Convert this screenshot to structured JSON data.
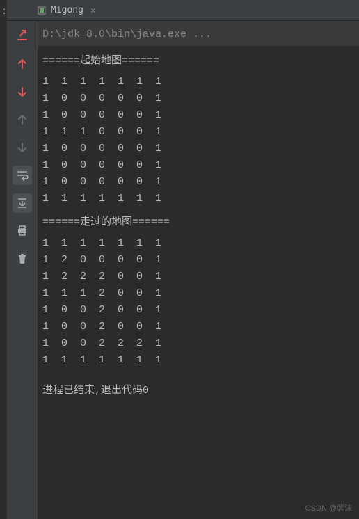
{
  "left_label": ":",
  "tab": {
    "name": "Migong",
    "close": "×"
  },
  "console": {
    "command": "D:\\jdk_8.0\\bin\\java.exe ...",
    "header1": "======起始地图======",
    "grid1": [
      "1 1 1 1 1 1 1",
      "1 0 0 0 0 0 1",
      "1 0 0 0 0 0 1",
      "1 1 1 0 0 0 1",
      "1 0 0 0 0 0 1",
      "1 0 0 0 0 0 1",
      "1 0 0 0 0 0 1",
      "1 1 1 1 1 1 1"
    ],
    "header2": "======走过的地图======",
    "grid2": [
      "1 1 1 1 1 1 1",
      "1 2 0 0 0 0 1",
      "1 2 2 2 0 0 1",
      "1 1 1 2 0 0 1",
      "1 0 0 2 0 0 1",
      "1 0 0 2 0 0 1",
      "1 0 0 2 2 2 1",
      "1 1 1 1 1 1 1"
    ],
    "exit_msg": "进程已结束,退出代码0"
  },
  "watermark": "CSDN @裴沫",
  "icons": {
    "rerun": "rerun-icon",
    "up": "arrow-up-icon",
    "down": "arrow-down-icon",
    "up_gray": "arrow-up-gray-icon",
    "down_gray": "arrow-down-gray-icon",
    "wrap": "wrap-icon",
    "scroll": "scroll-to-end-icon",
    "print": "print-icon",
    "trash": "trash-icon"
  }
}
